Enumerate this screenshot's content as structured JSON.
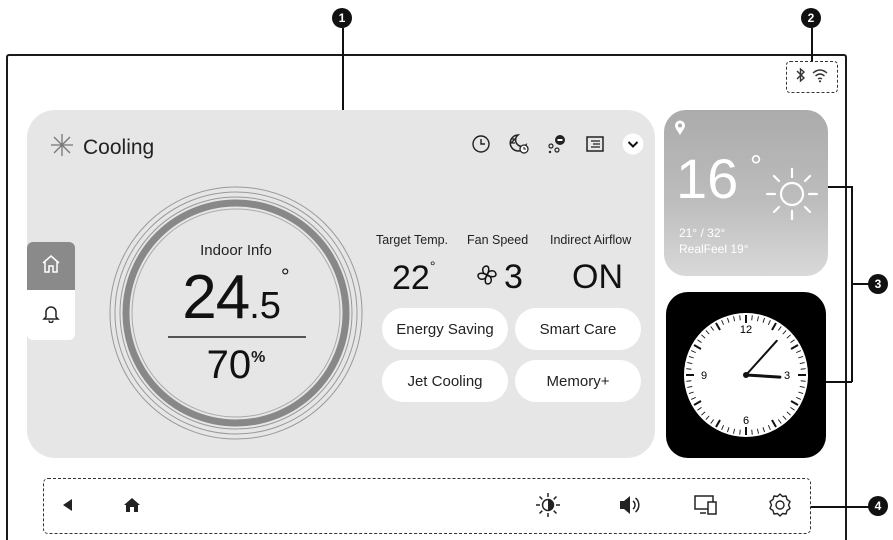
{
  "callouts": [
    "1",
    "2",
    "3",
    "4"
  ],
  "mode": {
    "label": "Cooling",
    "icon": "snowflake-icon"
  },
  "status_icons": [
    "timer-icon",
    "sleep-mode-icon",
    "air-purify-icon",
    "display-icon",
    "expand-chevron-icon"
  ],
  "side_tabs": [
    {
      "icon": "home-icon",
      "selected": true
    },
    {
      "icon": "bell-icon",
      "selected": false
    }
  ],
  "indoor": {
    "title": "Indoor Info",
    "temp_int": "24",
    "temp_dec": ".5",
    "temp_unit": "°",
    "humidity": "70",
    "humidity_unit": "%"
  },
  "stats": {
    "target_label": "Target Temp.",
    "target_value": "22",
    "target_unit": "°",
    "fan_label": "Fan Speed",
    "fan_value": "3",
    "airflow_label": "Indirect Airflow",
    "airflow_value": "ON"
  },
  "buttons": {
    "energy_saving": "Energy Saving",
    "smart_care": "Smart Care",
    "jet_cooling": "Jet Cooling",
    "memory_plus": "Memory+"
  },
  "weather": {
    "temp": "16",
    "unit": "°",
    "range": "21° / 32°",
    "realfeel": "RealFeel 19°",
    "condition_icon": "sun-icon"
  },
  "clock": {
    "hour": 3,
    "minute": 7,
    "numerals": [
      "12",
      "3",
      "6",
      "9"
    ]
  },
  "connectivity": [
    "bluetooth-icon",
    "wifi-icon"
  ],
  "nav": [
    "back-icon",
    "home-icon",
    "brightness-icon",
    "volume-icon",
    "screen-mirroring-icon",
    "settings-icon"
  ],
  "colors": {
    "panel": "#e6e6e6",
    "accent_dark": "#111111",
    "home_tab": "#8a8a8a"
  }
}
